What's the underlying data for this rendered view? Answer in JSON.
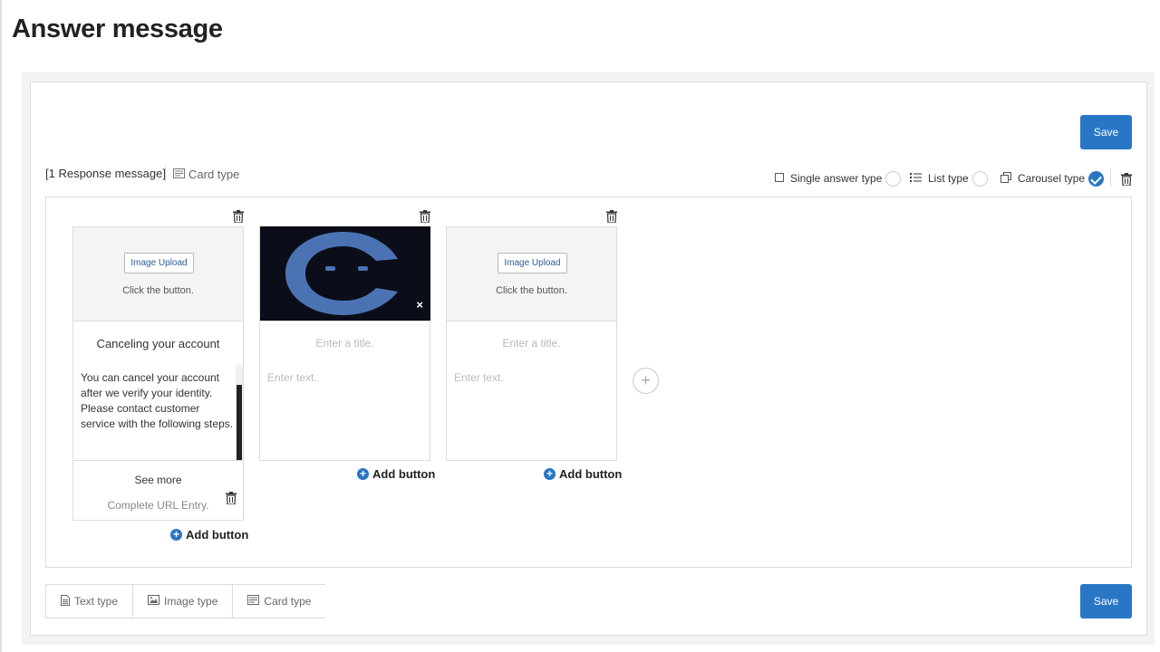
{
  "page": {
    "title": "Answer message"
  },
  "toolbar": {
    "save_label": "Save",
    "response_label": "[1 Response message]",
    "card_type_label": "Card type",
    "types": [
      {
        "label": "Single answer type",
        "icon": "checkbox-icon",
        "checked": false
      },
      {
        "label": "List type",
        "icon": "list-icon",
        "checked": false
      },
      {
        "label": "Carousel type",
        "icon": "copy-icon",
        "checked": true
      }
    ]
  },
  "cards": [
    {
      "upload_label": "Image Upload",
      "upload_hint": "Click the button.",
      "title": "Canceling your account",
      "text": "You can cancel your account after we verify your identity. Please contact customer service with the following steps.",
      "button_label": "See more",
      "button_url": "Complete URL Entry.",
      "add_button_label": "Add button"
    },
    {
      "title_placeholder": "Enter a title.",
      "text_placeholder": "Enter text.",
      "add_button_label": "Add button",
      "remove_icon": "×"
    },
    {
      "upload_label": "Image Upload",
      "upload_hint": "Click the button.",
      "title_placeholder": "Enter a title.",
      "text_placeholder": "Enter text.",
      "add_button_label": "Add button"
    }
  ],
  "add_card_icon": "+",
  "bottom_tabs": [
    {
      "label": "Text type",
      "icon": "document-icon"
    },
    {
      "label": "Image type",
      "icon": "image-icon"
    },
    {
      "label": "Card type",
      "icon": "card-icon"
    }
  ],
  "colors": {
    "accent": "#2a76c6",
    "panel_bg": "#f3f3f3"
  }
}
